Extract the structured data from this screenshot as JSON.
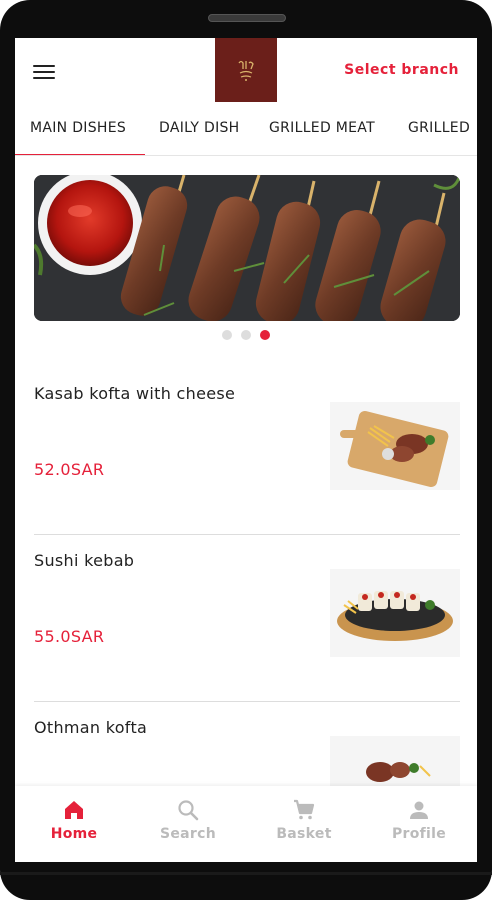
{
  "header": {
    "menu_icon": "hamburger-menu-icon",
    "logo_icon": "restaurant-logo-icon",
    "select_branch_label": "Select branch"
  },
  "tabs": [
    {
      "label": "MAIN DISHES",
      "active": true
    },
    {
      "label": "DAILY DISH",
      "active": false
    },
    {
      "label": "GRILLED MEAT",
      "active": false
    },
    {
      "label": "GRILLED",
      "active": false
    }
  ],
  "banner": {
    "dots_count": 3,
    "active_dot": 3
  },
  "items": [
    {
      "name": "Kasab kofta with cheese",
      "price": "52.0SAR"
    },
    {
      "name": "Sushi kebab",
      "price": "55.0SAR"
    },
    {
      "name": "Othman kofta",
      "price": ""
    }
  ],
  "bottom_nav": [
    {
      "label": "Home",
      "icon": "home-icon",
      "active": true
    },
    {
      "label": "Search",
      "icon": "search-icon",
      "active": false
    },
    {
      "label": "Basket",
      "icon": "cart-icon",
      "active": false
    },
    {
      "label": "Profile",
      "icon": "person-icon",
      "active": false
    }
  ],
  "colors": {
    "accent": "#e5213a",
    "logo_bg": "#6b1f1a",
    "inactive": "#bbbbbb"
  }
}
